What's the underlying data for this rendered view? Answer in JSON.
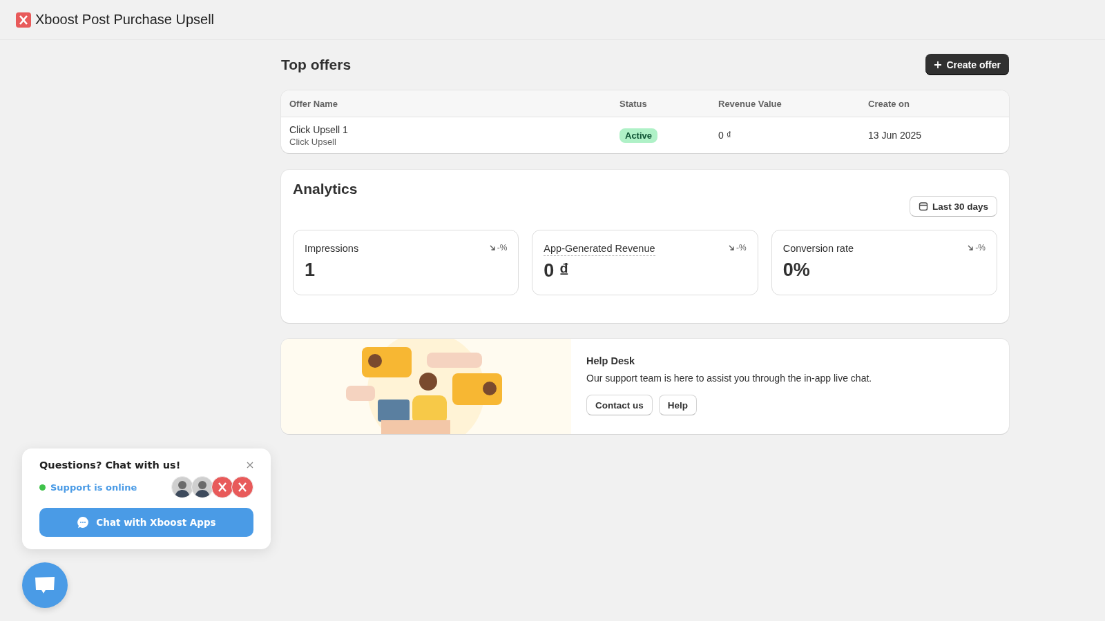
{
  "app": {
    "title": "Xboost Post Purchase Upsell"
  },
  "top_offers": {
    "title": "Top offers",
    "create_button": "Create offer",
    "table": {
      "columns": [
        "Offer Name",
        "Status",
        "Revenue Value",
        "Create on"
      ],
      "rows": [
        {
          "name": "Click Upsell 1",
          "type": "Click Upsell",
          "status": "Active",
          "revenue": "0 ₫",
          "created": "13 Jun 2025"
        }
      ]
    }
  },
  "analytics": {
    "title": "Analytics",
    "date_range": "Last 30 days",
    "metrics": [
      {
        "label": "Impressions",
        "value": "1",
        "trend": "-%",
        "dotted": false
      },
      {
        "label": "App-Generated Revenue",
        "value": "0 ₫",
        "trend": "-%",
        "dotted": true
      },
      {
        "label": "Conversion rate",
        "value": "0%",
        "trend": "-%",
        "dotted": false
      }
    ]
  },
  "help_desk": {
    "title": "Help Desk",
    "text": "Our support team is here to assist you through the in-app live chat.",
    "buttons": [
      "Contact us",
      "Help"
    ]
  },
  "chat_widget": {
    "title": "Questions? Chat with us!",
    "status": "Support is online",
    "online": true,
    "avatars": [
      {
        "kind": "person"
      },
      {
        "kind": "person"
      },
      {
        "kind": "logo"
      },
      {
        "kind": "logo"
      }
    ],
    "button": "Chat with Xboost Apps"
  }
}
